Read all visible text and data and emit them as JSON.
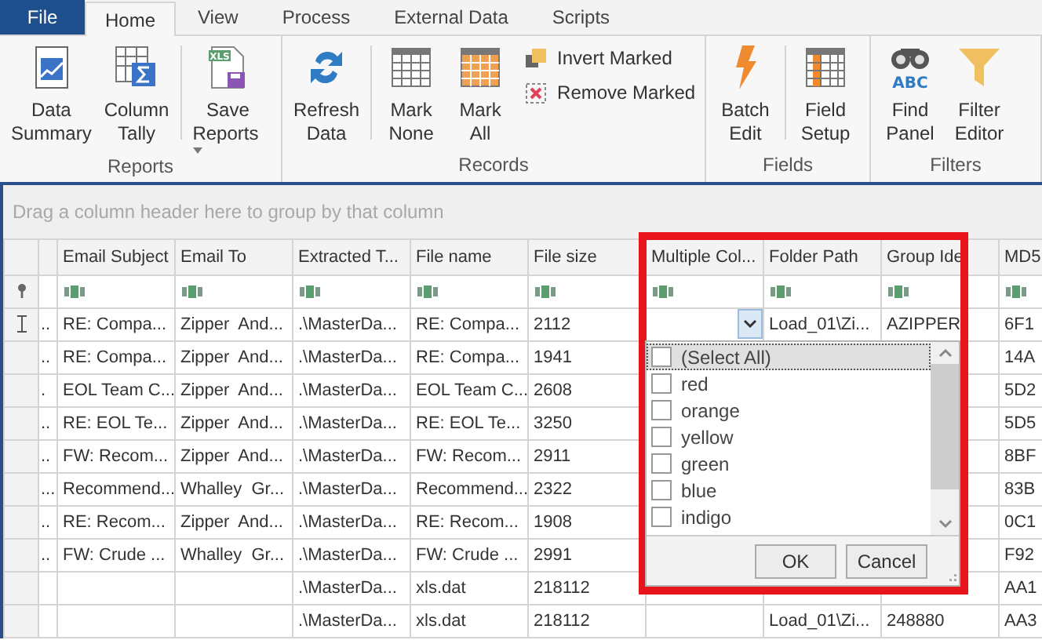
{
  "menu_tabs": [
    {
      "label": "File",
      "kind": "file",
      "selected": false
    },
    {
      "label": "Home",
      "kind": "tab",
      "selected": true
    },
    {
      "label": "View",
      "kind": "tab",
      "selected": false
    },
    {
      "label": "Process",
      "kind": "tab",
      "selected": false
    },
    {
      "label": "External Data",
      "kind": "tab",
      "selected": false
    },
    {
      "label": "Scripts",
      "kind": "tab",
      "selected": false
    }
  ],
  "ribbon_groups": [
    {
      "label": "Reports",
      "items": [
        {
          "kind": "large",
          "lines": [
            "Data",
            "Summary"
          ]
        },
        {
          "kind": "large",
          "lines": [
            "Column",
            "Tally"
          ],
          "separator_after": true
        },
        {
          "kind": "large",
          "lines": [
            "Save",
            "Reports"
          ],
          "dropdown": true,
          "icon_text": "XLS"
        }
      ]
    },
    {
      "label": "Records",
      "items": [
        {
          "kind": "large",
          "lines": [
            "Refresh",
            "Data"
          ],
          "separator_after": true
        },
        {
          "kind": "large",
          "lines": [
            "Mark",
            "None"
          ]
        },
        {
          "kind": "large",
          "lines": [
            "Mark",
            "All"
          ]
        },
        {
          "kind": "small",
          "lines": [
            "Invert Marked"
          ]
        },
        {
          "kind": "small",
          "lines": [
            "Remove Marked"
          ]
        }
      ]
    },
    {
      "label": "Fields",
      "items": [
        {
          "kind": "large",
          "lines": [
            "Batch",
            "Edit"
          ],
          "separator_after": true
        },
        {
          "kind": "large",
          "lines": [
            "Field",
            "Setup"
          ]
        }
      ]
    },
    {
      "label": "Filters",
      "items": [
        {
          "kind": "large",
          "lines": [
            "Find",
            "Panel"
          ],
          "icon_text": "ABC"
        },
        {
          "kind": "large",
          "lines": [
            "Filter",
            "Editor"
          ]
        }
      ]
    }
  ],
  "group_panel": {
    "hint": "Drag a column header here to group by that column"
  },
  "grid": {
    "columns": [
      "",
      "Email Subject",
      "Email To",
      "Extracted T...",
      "File name",
      "File size",
      "Multiple Col...",
      "Folder Path",
      "Group Ide",
      "MD5"
    ],
    "rows": [
      {
        "focused": true,
        "cells": [
          "..",
          "RE: Compa...",
          "Zipper  And...",
          ".\\MasterDa...",
          "RE: Compa...",
          "2112",
          "",
          "Load_01\\Zi...",
          "AZIPPER",
          "6F1"
        ]
      },
      {
        "focused": false,
        "cells": [
          "..",
          "RE: Compa...",
          "Zipper  And...",
          ".\\MasterDa...",
          "RE: Compa...",
          "1941",
          "",
          "",
          "",
          "14A"
        ]
      },
      {
        "focused": false,
        "cells": [
          ".",
          "EOL Team C...",
          "Zipper  And...",
          ".\\MasterDa...",
          "EOL Team C...",
          "2608",
          "",
          "",
          "",
          "5D2"
        ]
      },
      {
        "focused": false,
        "cells": [
          "..",
          "RE: EOL Te...",
          "Zipper  And...",
          ".\\MasterDa...",
          "RE: EOL Te...",
          "3250",
          "",
          "",
          "",
          "5D5"
        ]
      },
      {
        "focused": false,
        "cells": [
          "..",
          "FW: Recom...",
          "Zipper  And...",
          ".\\MasterDa...",
          "FW: Recom...",
          "2911",
          "",
          "",
          "",
          "8BF"
        ]
      },
      {
        "focused": false,
        "cells": [
          "...",
          "Recommend...",
          "Whalley  Gr...",
          ".\\MasterDa...",
          "Recommend...",
          "2322",
          "",
          "",
          "",
          "83B"
        ]
      },
      {
        "focused": false,
        "cells": [
          "..",
          "RE: Recom...",
          "Zipper  And...",
          ".\\MasterDa...",
          "RE: Recom...",
          "1908",
          "",
          "",
          "",
          "0C1"
        ]
      },
      {
        "focused": false,
        "cells": [
          "..",
          "FW: Crude ...",
          "Whalley  Gr...",
          ".\\MasterDa...",
          "FW: Crude ...",
          "2991",
          "",
          "",
          "",
          "F92"
        ]
      },
      {
        "focused": false,
        "cells": [
          "",
          "",
          "",
          ".\\MasterDa...",
          "xls.dat",
          "218112",
          "",
          "",
          "",
          "AA1"
        ]
      },
      {
        "focused": false,
        "cells": [
          "",
          "",
          "",
          ".\\MasterDa...",
          "xls.dat",
          "218112",
          "",
          "Load_01\\Zi...",
          "248880",
          "AA3"
        ]
      }
    ]
  },
  "filter_popup": {
    "items": [
      {
        "label": "(Select All)",
        "checked": false,
        "selected": true
      },
      {
        "label": "red",
        "checked": false,
        "selected": false
      },
      {
        "label": "orange",
        "checked": false,
        "selected": false
      },
      {
        "label": "yellow",
        "checked": false,
        "selected": false
      },
      {
        "label": "green",
        "checked": false,
        "selected": false
      },
      {
        "label": "blue",
        "checked": false,
        "selected": false
      },
      {
        "label": "indigo",
        "checked": false,
        "selected": false
      }
    ],
    "buttons": [
      "OK",
      "Cancel"
    ]
  }
}
